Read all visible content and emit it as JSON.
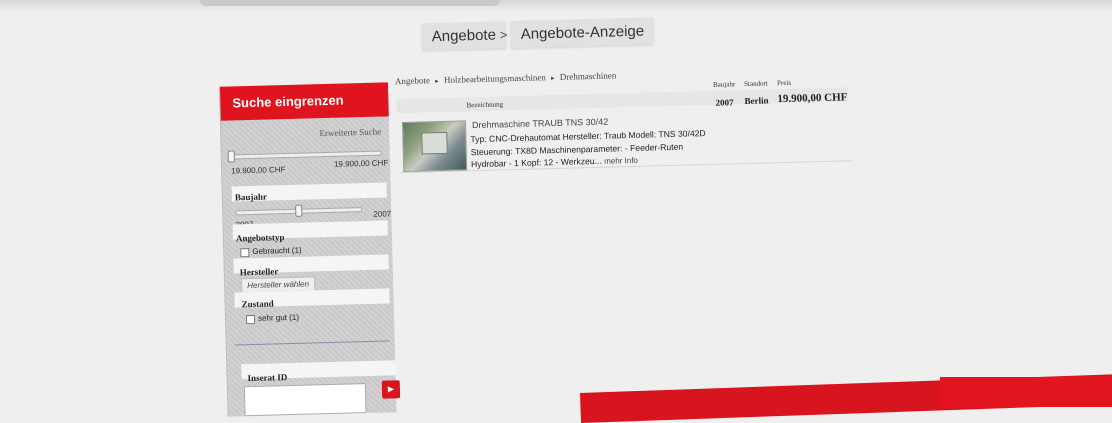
{
  "nav": {
    "crumb1": "Angebote",
    "sep": ">",
    "crumb2": "Angebote-Anzeige"
  },
  "sidebar": {
    "title": "Suche eingrenzen",
    "advanced_link": "Erweiterte Suche",
    "price_min": "19.900,00 CHF",
    "price_max": "19.900,00 CHF",
    "year_label": "Baujahr",
    "year_min": "2007",
    "year_max": "2007",
    "type_label": "Angebotstyp",
    "type_option": "Gebraucht (1)",
    "manufacturer_label": "Hersteller",
    "manufacturer_select": "Hersteller wählen",
    "condition_label": "Zustand",
    "condition_option": "sehr gut (1)",
    "id_label": "Inserat ID",
    "go_icon": "play-arrow-icon"
  },
  "breadcrumb": {
    "items": [
      "Angebote",
      "Holzbearbeitungsmaschinen",
      "Drehmaschinen"
    ],
    "sep_icon": "▸"
  },
  "table": {
    "col_year": "Baujahr",
    "col_location": "Standort",
    "col_price": "Preis",
    "col_desc": "Bezeichnung"
  },
  "listing": {
    "title": "Drehmaschine TRAUB TNS 30/42",
    "description": "Typ: CNC-Drehautomat Hersteller: Traub Modell: TNS 30/42D Steuerung: TX8D Maschinenparameter: - Feeder-Ruten Hydrobar - 1 Kopf: 12 - Werkzeu...",
    "more": "mehr Info",
    "year": "2007",
    "location": "Berlin",
    "price": "19.900,00 CHF"
  },
  "colors": {
    "accent": "#e0141e",
    "background": "#efefef"
  }
}
